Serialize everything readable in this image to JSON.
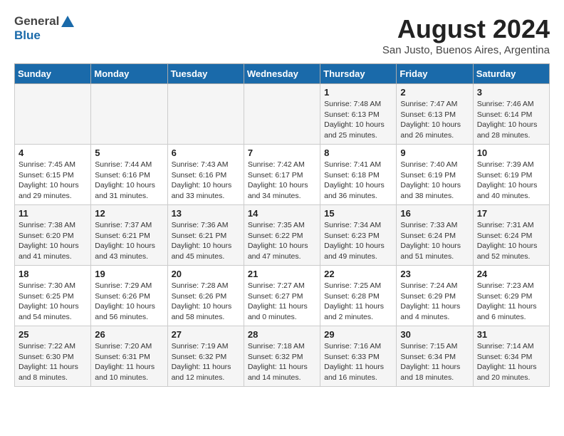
{
  "header": {
    "logo_line1": "General",
    "logo_line2": "Blue",
    "title": "August 2024",
    "subtitle": "San Justo, Buenos Aires, Argentina"
  },
  "days_of_week": [
    "Sunday",
    "Monday",
    "Tuesday",
    "Wednesday",
    "Thursday",
    "Friday",
    "Saturday"
  ],
  "weeks": [
    [
      {
        "day": "",
        "info": ""
      },
      {
        "day": "",
        "info": ""
      },
      {
        "day": "",
        "info": ""
      },
      {
        "day": "",
        "info": ""
      },
      {
        "day": "1",
        "info": "Sunrise: 7:48 AM\nSunset: 6:13 PM\nDaylight: 10 hours\nand 25 minutes."
      },
      {
        "day": "2",
        "info": "Sunrise: 7:47 AM\nSunset: 6:13 PM\nDaylight: 10 hours\nand 26 minutes."
      },
      {
        "day": "3",
        "info": "Sunrise: 7:46 AM\nSunset: 6:14 PM\nDaylight: 10 hours\nand 28 minutes."
      }
    ],
    [
      {
        "day": "4",
        "info": "Sunrise: 7:45 AM\nSunset: 6:15 PM\nDaylight: 10 hours\nand 29 minutes."
      },
      {
        "day": "5",
        "info": "Sunrise: 7:44 AM\nSunset: 6:16 PM\nDaylight: 10 hours\nand 31 minutes."
      },
      {
        "day": "6",
        "info": "Sunrise: 7:43 AM\nSunset: 6:16 PM\nDaylight: 10 hours\nand 33 minutes."
      },
      {
        "day": "7",
        "info": "Sunrise: 7:42 AM\nSunset: 6:17 PM\nDaylight: 10 hours\nand 34 minutes."
      },
      {
        "day": "8",
        "info": "Sunrise: 7:41 AM\nSunset: 6:18 PM\nDaylight: 10 hours\nand 36 minutes."
      },
      {
        "day": "9",
        "info": "Sunrise: 7:40 AM\nSunset: 6:19 PM\nDaylight: 10 hours\nand 38 minutes."
      },
      {
        "day": "10",
        "info": "Sunrise: 7:39 AM\nSunset: 6:19 PM\nDaylight: 10 hours\nand 40 minutes."
      }
    ],
    [
      {
        "day": "11",
        "info": "Sunrise: 7:38 AM\nSunset: 6:20 PM\nDaylight: 10 hours\nand 41 minutes."
      },
      {
        "day": "12",
        "info": "Sunrise: 7:37 AM\nSunset: 6:21 PM\nDaylight: 10 hours\nand 43 minutes."
      },
      {
        "day": "13",
        "info": "Sunrise: 7:36 AM\nSunset: 6:21 PM\nDaylight: 10 hours\nand 45 minutes."
      },
      {
        "day": "14",
        "info": "Sunrise: 7:35 AM\nSunset: 6:22 PM\nDaylight: 10 hours\nand 47 minutes."
      },
      {
        "day": "15",
        "info": "Sunrise: 7:34 AM\nSunset: 6:23 PM\nDaylight: 10 hours\nand 49 minutes."
      },
      {
        "day": "16",
        "info": "Sunrise: 7:33 AM\nSunset: 6:24 PM\nDaylight: 10 hours\nand 51 minutes."
      },
      {
        "day": "17",
        "info": "Sunrise: 7:31 AM\nSunset: 6:24 PM\nDaylight: 10 hours\nand 52 minutes."
      }
    ],
    [
      {
        "day": "18",
        "info": "Sunrise: 7:30 AM\nSunset: 6:25 PM\nDaylight: 10 hours\nand 54 minutes."
      },
      {
        "day": "19",
        "info": "Sunrise: 7:29 AM\nSunset: 6:26 PM\nDaylight: 10 hours\nand 56 minutes."
      },
      {
        "day": "20",
        "info": "Sunrise: 7:28 AM\nSunset: 6:26 PM\nDaylight: 10 hours\nand 58 minutes."
      },
      {
        "day": "21",
        "info": "Sunrise: 7:27 AM\nSunset: 6:27 PM\nDaylight: 11 hours\nand 0 minutes."
      },
      {
        "day": "22",
        "info": "Sunrise: 7:25 AM\nSunset: 6:28 PM\nDaylight: 11 hours\nand 2 minutes."
      },
      {
        "day": "23",
        "info": "Sunrise: 7:24 AM\nSunset: 6:29 PM\nDaylight: 11 hours\nand 4 minutes."
      },
      {
        "day": "24",
        "info": "Sunrise: 7:23 AM\nSunset: 6:29 PM\nDaylight: 11 hours\nand 6 minutes."
      }
    ],
    [
      {
        "day": "25",
        "info": "Sunrise: 7:22 AM\nSunset: 6:30 PM\nDaylight: 11 hours\nand 8 minutes."
      },
      {
        "day": "26",
        "info": "Sunrise: 7:20 AM\nSunset: 6:31 PM\nDaylight: 11 hours\nand 10 minutes."
      },
      {
        "day": "27",
        "info": "Sunrise: 7:19 AM\nSunset: 6:32 PM\nDaylight: 11 hours\nand 12 minutes."
      },
      {
        "day": "28",
        "info": "Sunrise: 7:18 AM\nSunset: 6:32 PM\nDaylight: 11 hours\nand 14 minutes."
      },
      {
        "day": "29",
        "info": "Sunrise: 7:16 AM\nSunset: 6:33 PM\nDaylight: 11 hours\nand 16 minutes."
      },
      {
        "day": "30",
        "info": "Sunrise: 7:15 AM\nSunset: 6:34 PM\nDaylight: 11 hours\nand 18 minutes."
      },
      {
        "day": "31",
        "info": "Sunrise: 7:14 AM\nSunset: 6:34 PM\nDaylight: 11 hours\nand 20 minutes."
      }
    ]
  ]
}
